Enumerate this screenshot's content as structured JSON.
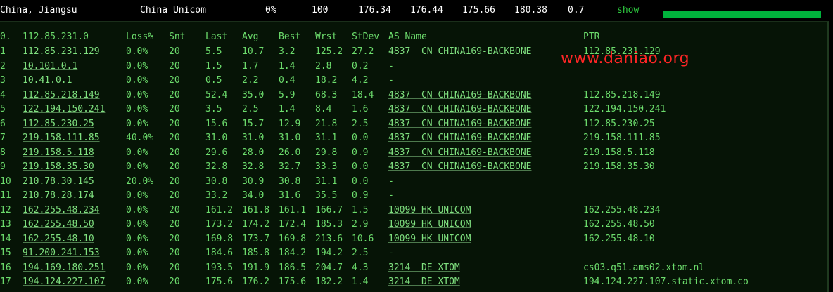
{
  "header": {
    "location": "China, Jiangsu",
    "isp": "China Unicom",
    "loss": "0%",
    "snt": "100",
    "last": "176.34",
    "avg": "176.44",
    "best": "175.66",
    "wrst": "180.38",
    "stdev": "0.7",
    "show_label": "show",
    "bar_color": "#00b33c"
  },
  "table": {
    "columns": [
      "0.",
      "112.85.231.0",
      "Loss%",
      "Snt",
      "Last",
      "Avg",
      "Best",
      "Wrst",
      "StDev",
      "AS Name",
      "PTR"
    ],
    "rows": [
      {
        "no": "1",
        "host": "112.85.231.129",
        "loss": "0.0%",
        "snt": "20",
        "last": "5.5",
        "avg": "10.7",
        "best": "3.2",
        "wrst": "125.2",
        "stdev": "27.2",
        "as": "4837  CN CHINA169-BACKBONE",
        "ptr": "112.85.231.129"
      },
      {
        "no": "2",
        "host": "10.101.0.1",
        "loss": "0.0%",
        "snt": "20",
        "last": "1.5",
        "avg": "1.7",
        "best": "1.4",
        "wrst": "2.8",
        "stdev": "0.2",
        "as": "-",
        "ptr": ""
      },
      {
        "no": "3",
        "host": "10.41.0.1",
        "loss": "0.0%",
        "snt": "20",
        "last": "0.5",
        "avg": "2.2",
        "best": "0.4",
        "wrst": "18.2",
        "stdev": "4.2",
        "as": "-",
        "ptr": ""
      },
      {
        "no": "4",
        "host": "112.85.218.149",
        "loss": "0.0%",
        "snt": "20",
        "last": "52.4",
        "avg": "35.0",
        "best": "5.9",
        "wrst": "68.3",
        "stdev": "18.4",
        "as": "4837  CN CHINA169-BACKBONE",
        "ptr": "112.85.218.149"
      },
      {
        "no": "5",
        "host": "122.194.150.241",
        "loss": "0.0%",
        "snt": "20",
        "last": "3.5",
        "avg": "2.5",
        "best": "1.4",
        "wrst": "8.4",
        "stdev": "1.6",
        "as": "4837  CN CHINA169-BACKBONE",
        "ptr": "122.194.150.241"
      },
      {
        "no": "6",
        "host": "112.85.230.25",
        "loss": "0.0%",
        "snt": "20",
        "last": "15.6",
        "avg": "15.7",
        "best": "12.9",
        "wrst": "21.8",
        "stdev": "2.5",
        "as": "4837  CN CHINA169-BACKBONE",
        "ptr": "112.85.230.25"
      },
      {
        "no": "7",
        "host": "219.158.111.85",
        "loss": "40.0%",
        "snt": "20",
        "last": "31.0",
        "avg": "31.0",
        "best": "31.0",
        "wrst": "31.1",
        "stdev": "0.0",
        "as": "4837  CN CHINA169-BACKBONE",
        "ptr": "219.158.111.85"
      },
      {
        "no": "8",
        "host": "219.158.5.118",
        "loss": "0.0%",
        "snt": "20",
        "last": "29.6",
        "avg": "28.0",
        "best": "26.0",
        "wrst": "29.8",
        "stdev": "0.9",
        "as": "4837  CN CHINA169-BACKBONE",
        "ptr": "219.158.5.118"
      },
      {
        "no": "9",
        "host": "219.158.35.30",
        "loss": "0.0%",
        "snt": "20",
        "last": "32.8",
        "avg": "32.8",
        "best": "32.7",
        "wrst": "33.3",
        "stdev": "0.0",
        "as": "4837  CN CHINA169-BACKBONE",
        "ptr": "219.158.35.30"
      },
      {
        "no": "10",
        "host": "210.78.30.145",
        "loss": "20.0%",
        "snt": "20",
        "last": "30.8",
        "avg": "30.9",
        "best": "30.8",
        "wrst": "31.1",
        "stdev": "0.0",
        "as": "-",
        "ptr": ""
      },
      {
        "no": "11",
        "host": "210.78.28.174",
        "loss": "0.0%",
        "snt": "20",
        "last": "33.2",
        "avg": "34.0",
        "best": "31.6",
        "wrst": "35.5",
        "stdev": "0.9",
        "as": "-",
        "ptr": ""
      },
      {
        "no": "12",
        "host": "162.255.48.234",
        "loss": "0.0%",
        "snt": "20",
        "last": "161.2",
        "avg": "161.8",
        "best": "161.1",
        "wrst": "166.7",
        "stdev": "1.5",
        "as": "10099 HK UNICOM",
        "ptr": "162.255.48.234"
      },
      {
        "no": "13",
        "host": "162.255.48.50",
        "loss": "0.0%",
        "snt": "20",
        "last": "173.2",
        "avg": "174.2",
        "best": "172.4",
        "wrst": "185.3",
        "stdev": "2.9",
        "as": "10099 HK UNICOM",
        "ptr": "162.255.48.50"
      },
      {
        "no": "14",
        "host": "162.255.48.10",
        "loss": "0.0%",
        "snt": "20",
        "last": "169.8",
        "avg": "173.7",
        "best": "169.8",
        "wrst": "213.6",
        "stdev": "10.6",
        "as": "10099 HK UNICOM",
        "ptr": "162.255.48.10"
      },
      {
        "no": "15",
        "host": "91.200.241.153",
        "loss": "0.0%",
        "snt": "20",
        "last": "184.6",
        "avg": "185.8",
        "best": "184.2",
        "wrst": "194.2",
        "stdev": "2.5",
        "as": "-",
        "ptr": ""
      },
      {
        "no": "16",
        "host": "194.169.180.251",
        "loss": "0.0%",
        "snt": "20",
        "last": "193.5",
        "avg": "191.9",
        "best": "186.5",
        "wrst": "204.7",
        "stdev": "4.3",
        "as": "3214  DE XTOM",
        "ptr": "cs03.q51.ams02.xtom.nl"
      },
      {
        "no": "17",
        "host": "194.124.227.107",
        "loss": "0.0%",
        "snt": "20",
        "last": "175.6",
        "avg": "176.2",
        "best": "175.6",
        "wrst": "182.2",
        "stdev": "1.4",
        "as": "3214  DE XTOM",
        "ptr": "194.124.227.107.static.xtom.co"
      }
    ]
  },
  "watermark": "www.daniao.org"
}
